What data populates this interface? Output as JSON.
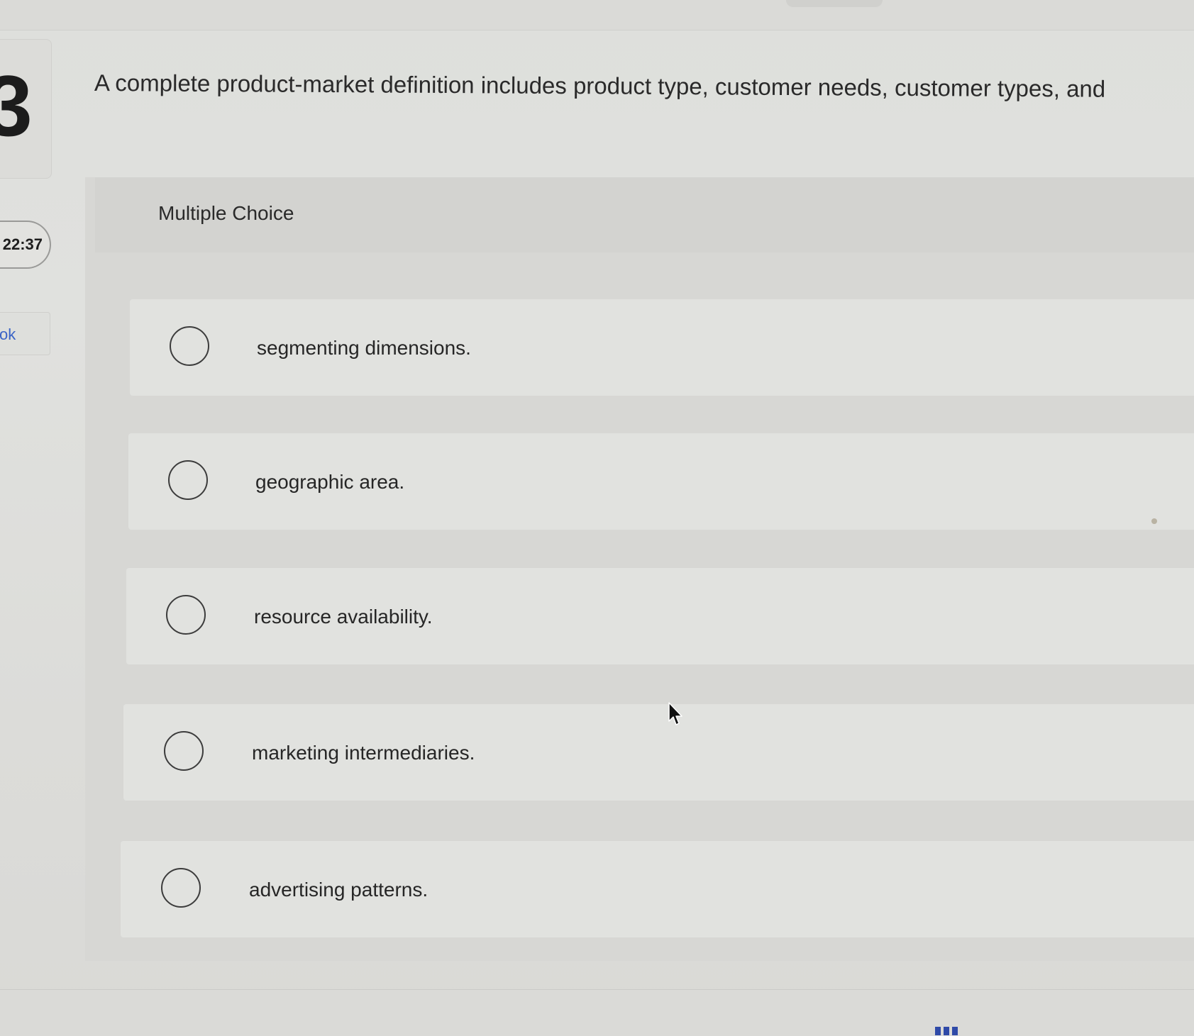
{
  "question": {
    "number": "3",
    "prompt": "A complete product-market definition includes product type, customer needs, customer types, and"
  },
  "sidebar": {
    "timer": "22:37",
    "link_fragment": "ok"
  },
  "answer_format": {
    "label": "Multiple Choice"
  },
  "choices": [
    {
      "label": "segmenting dimensions.",
      "selected": false
    },
    {
      "label": "geographic area.",
      "selected": false
    },
    {
      "label": "resource availability.",
      "selected": false
    },
    {
      "label": "marketing intermediaries.",
      "selected": false
    },
    {
      "label": "advertising patterns.",
      "selected": false
    }
  ],
  "icons": {
    "radio": "radio-button-icon",
    "cursor": "mouse-pointer-icon"
  },
  "colors": {
    "link": "#3a63c6",
    "text": "#2a2a2a",
    "panel": "#d7d7d4",
    "choice_row": "#e1e2df"
  }
}
